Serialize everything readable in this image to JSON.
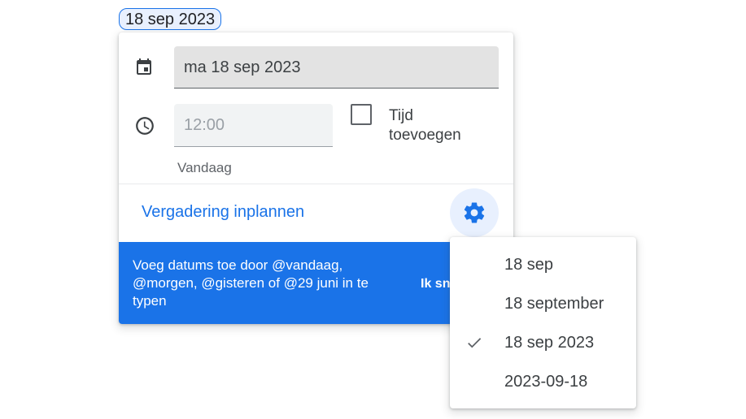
{
  "chip": {
    "label": "18 sep 2023"
  },
  "card": {
    "date_value": "ma 18 sep 2023",
    "time_placeholder": "12:00",
    "add_time_label": "Tijd toevoegen",
    "helper_text": "Vandaag",
    "schedule_meeting_label": "Vergadering inplannen",
    "banner": {
      "text": "Voeg datums toe door @vandaag, @morgen, @gisteren of @29 juni in te typen",
      "action": "Ik sn"
    }
  },
  "menu": {
    "items": [
      {
        "label": "18 sep",
        "selected": false
      },
      {
        "label": "18 september",
        "selected": false
      },
      {
        "label": "18 sep 2023",
        "selected": true
      },
      {
        "label": "2023-09-18",
        "selected": false
      }
    ]
  },
  "colors": {
    "accent": "#1a73e8",
    "banner": "#1a73e8",
    "field_bg": "#e3e3e3"
  },
  "icons": [
    "calendar-icon",
    "clock-icon",
    "gear-icon",
    "checkmark-icon"
  ]
}
